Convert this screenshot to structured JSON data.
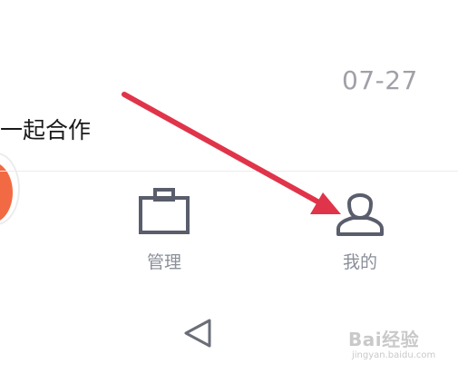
{
  "list_item": {
    "date": "07-27",
    "text": "一起合作"
  },
  "tab_bar": {
    "tabs": [
      {
        "label": "管理",
        "icon": "briefcase-icon"
      },
      {
        "label": "我的",
        "icon": "person-icon"
      }
    ]
  },
  "nav_bar": {
    "back_icon": "back-triangle-icon"
  },
  "annotation": {
    "arrow_color": "#e0344a"
  },
  "watermark": {
    "main": "Bai经验",
    "sub": "jingyan.baidu.com"
  },
  "colors": {
    "tab_icon": "#5a5d6b",
    "tab_label": "#8a8f99",
    "date": "#a0a0a8",
    "avatar": "#f26a43"
  }
}
